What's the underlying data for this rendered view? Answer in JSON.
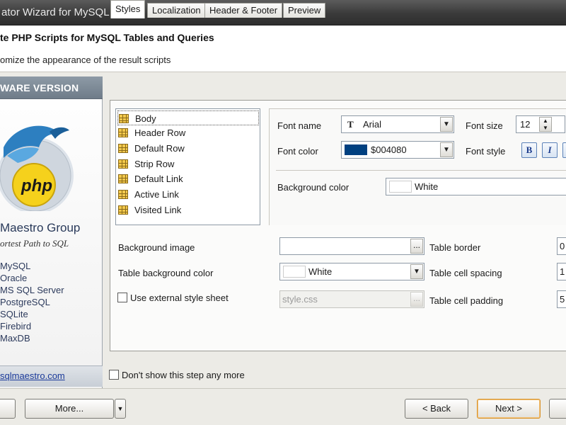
{
  "window": {
    "title": "ator Wizard for MySQL"
  },
  "header": {
    "title": "te PHP Scripts for MySQL Tables and Queries",
    "subtitle": "omize the appearance of the result scripts"
  },
  "left_panel": {
    "banner": "WARE VERSION",
    "company": "Maestro Group",
    "tagline": "ortest Path to SQL",
    "databases": [
      "MySQL",
      "Oracle",
      "MS SQL Server",
      "PostgreSQL",
      "SQLite",
      "Firebird",
      "MaxDB"
    ],
    "website": "sqlmaestro.com"
  },
  "tabs": [
    "Styles",
    "Localization",
    "Header & Footer",
    "Preview"
  ],
  "style_list": [
    "Body",
    "Header Row",
    "Default Row",
    "Strip Row",
    "Default Link",
    "Active Link",
    "Visited Link"
  ],
  "selected_style": "Body",
  "props": {
    "font_name_label": "Font name",
    "font_name_value": "Arial",
    "font_size_label": "Font size",
    "font_size_value": "12",
    "font_color_label": "Font color",
    "font_color_value": "$004080",
    "font_color_hex": "#004080",
    "font_style_label": "Font style",
    "bold_label": "B",
    "italic_label": "I",
    "bg_color_label": "Background color",
    "bg_color_value": "White"
  },
  "lower": {
    "bg_image_label": "Background image",
    "bg_image_value": "",
    "table_bg_label": "Table background color",
    "table_bg_value": "White",
    "ext_css_label": "Use external style sheet",
    "ext_css_value": "style.css",
    "table_border_label": "Table border",
    "table_border_value": "0",
    "cell_spacing_label": "Table cell spacing",
    "cell_spacing_value": "1",
    "cell_padding_label": "Table cell padding",
    "cell_padding_value": "5"
  },
  "footer": {
    "dont_show_label": "Don't show this step any more",
    "more_label": "More...",
    "back_label": "< Back",
    "next_label": "Next >"
  }
}
